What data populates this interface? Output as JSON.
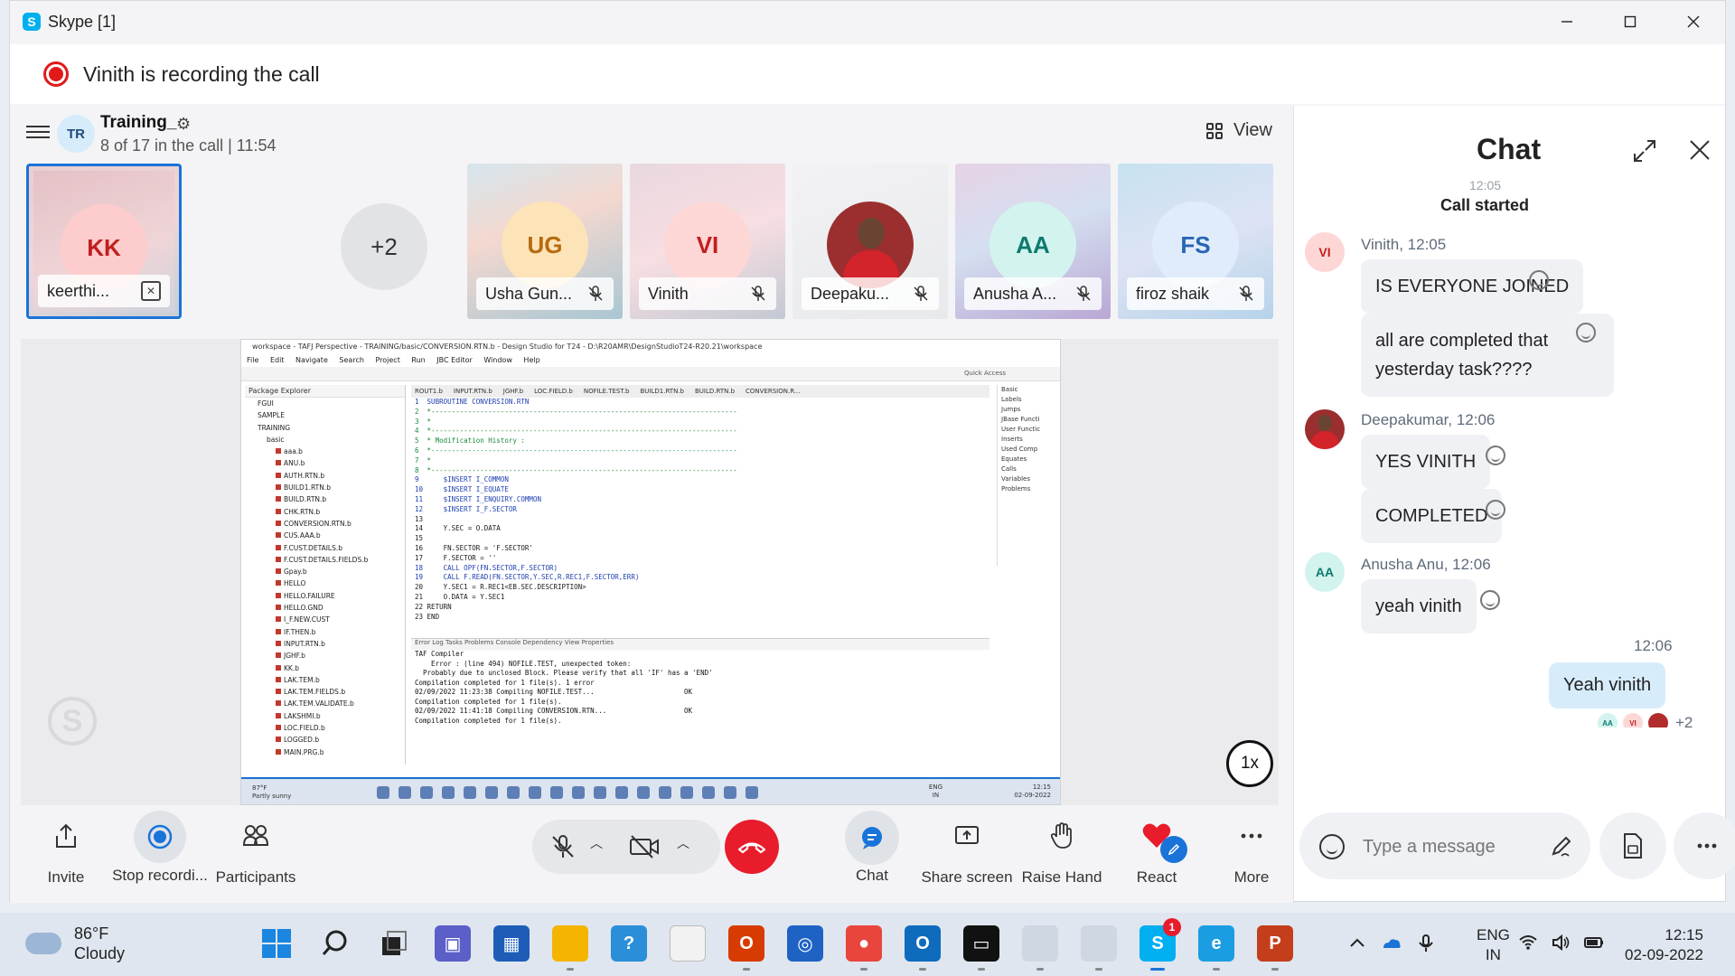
{
  "window": {
    "title": "Skype [1]"
  },
  "recording_banner": {
    "text": "Vinith is recording the call"
  },
  "call": {
    "group_initials": "TR",
    "group_name": "Training_",
    "status": "8 of 17 in the call | 11:54",
    "view_label": "View",
    "overflow_count": "+2"
  },
  "participants": [
    {
      "initials": "KK",
      "name": "keerthi..."
    },
    {
      "initials": "UG",
      "name": "Usha Gun..."
    },
    {
      "initials": "VI",
      "name": "Vinith"
    },
    {
      "initials": "",
      "name": "Deepaku..."
    },
    {
      "initials": "AA",
      "name": "Anusha A..."
    },
    {
      "initials": "FS",
      "name": "firoz shaik"
    }
  ],
  "shared_screen": {
    "speed": "1x",
    "window_title": "workspace - TAFJ Perspective - TRAINING/basic/CONVERSION.RTN.b - Design Studio for T24 - D:\\R20AMR\\DesignStudioT24-R20.21\\workspace",
    "menu": [
      "File",
      "Edit",
      "Navigate",
      "Search",
      "Project",
      "Run",
      "JBC Editor",
      "Window",
      "Help"
    ],
    "quick_access": "Quick Access",
    "package_explorer_title": "Package Explorer",
    "tree": [
      {
        "t": "FGUI",
        "l": 1
      },
      {
        "t": "SAMPLE",
        "l": 1
      },
      {
        "t": "TRAINING",
        "l": 1
      },
      {
        "t": "basic",
        "l": 2
      },
      {
        "t": "aaa.b",
        "l": 3
      },
      {
        "t": "ANU.b",
        "l": 3
      },
      {
        "t": "AUTH.RTN.b",
        "l": 3
      },
      {
        "t": "BUILD1.RTN.b",
        "l": 3
      },
      {
        "t": "BUILD.RTN.b",
        "l": 3
      },
      {
        "t": "CHK.RTN.b",
        "l": 3
      },
      {
        "t": "CONVERSION.RTN.b",
        "l": 3
      },
      {
        "t": "CUS.AAA.b",
        "l": 3
      },
      {
        "t": "F.CUST.DETAILS.b",
        "l": 3
      },
      {
        "t": "F.CUST.DETAILS.FIELDS.b",
        "l": 3
      },
      {
        "t": "Gpay.b",
        "l": 3
      },
      {
        "t": "HELLO",
        "l": 3
      },
      {
        "t": "HELLO.FAILURE",
        "l": 3
      },
      {
        "t": "HELLO.GND",
        "l": 3
      },
      {
        "t": "I_F.NEW.CUST",
        "l": 3
      },
      {
        "t": "IF.THEN.b",
        "l": 3
      },
      {
        "t": "INPUT.RTN.b",
        "l": 3
      },
      {
        "t": "JGHF.b",
        "l": 3
      },
      {
        "t": "KK.b",
        "l": 3
      },
      {
        "t": "LAK.TEM.b",
        "l": 3
      },
      {
        "t": "LAK.TEM.FIELDS.b",
        "l": 3
      },
      {
        "t": "LAK.TEM.VALIDATE.b",
        "l": 3
      },
      {
        "t": "LAKSHMI.b",
        "l": 3
      },
      {
        "t": "LOC.FIELD.b",
        "l": 3
      },
      {
        "t": "LOGGED.b",
        "l": 3
      },
      {
        "t": "MAIN.PRG.b",
        "l": 3
      }
    ],
    "editor_tabs": [
      "ROUT1.b",
      "INPUT.RTN.b",
      "JGHF.b",
      "LOC.FIELD.b",
      "NOFILE.TEST.b",
      "BUILD1.RTN.b",
      "BUILD.RTN.b",
      "CONVERSION.R..."
    ],
    "code_lines": [
      "1  SUBROUTINE CONVERSION.RTN",
      "2  *---------------------------------------------------------------------------",
      "3  *",
      "4  *---------------------------------------------------------------------------",
      "5  * Modification History :",
      "6  *---------------------------------------------------------------------------",
      "7  *",
      "8  *---------------------------------------------------------------------------",
      "9      $INSERT I_COMMON",
      "10     $INSERT I_EQUATE",
      "11     $INSERT I_ENQUIRY.COMMON",
      "12     $INSERT I_F.SECTOR",
      "13",
      "14     Y.SEC = O.DATA",
      "15",
      "16     FN.SECTOR = 'F.SECTOR'",
      "17     F.SECTOR = ''",
      "18     CALL OPF(FN.SECTOR,F.SECTOR)",
      "19     CALL F.READ(FN.SECTOR,Y.SEC,R.REC1,F.SECTOR,ERR)",
      "20     Y.SEC1 = R.REC1<EB.SEC.DESCRIPTION>",
      "21     O.DATA = Y.SEC1",
      "22 RETURN",
      "23 END"
    ],
    "outline": [
      "Basic",
      "Labels",
      "Jumps",
      "JBase Functi",
      "User Functic",
      "Inserts",
      "Used Comp",
      "Equates",
      "Calls",
      "Variables",
      "Problems"
    ],
    "console_tabs": "Error Log  Tasks  Problems  Console  Dependency View  Properties",
    "console_lines": [
      "TAF Compiler",
      "    Error : (line 494) NOFILE.TEST, unexpected token:",
      "  Probably due to unclosed Block. Please verify that all 'IF' has a 'END'",
      "Compilation completed for 1 file(s). 1 error",
      "02/09/2022 11:23:38 Compiling NOFILE.TEST...                      OK",
      "Compilation completed for 1 file(s).",
      "02/09/2022 11:41:18 Compiling CONVERSION.RTN...                   OK",
      "Compilation completed for 1 file(s)."
    ],
    "taskbar": {
      "temp": "87°F",
      "condition": "Partly sunny",
      "lang1": "ENG",
      "lang2": "IN",
      "time": "12:15",
      "date": "02-09-2022"
    }
  },
  "controls": {
    "invite": "Invite",
    "stop_recording": "Stop recordi...",
    "participants": "Participants",
    "chat": "Chat",
    "share_screen": "Share screen",
    "raise_hand": "Raise Hand",
    "react": "React",
    "more": "More"
  },
  "chat": {
    "title": "Chat",
    "cut_time": "12:05",
    "call_started": "Call started",
    "messages": [
      {
        "initials": "VI",
        "meta": "Vinith, 12:05",
        "texts": [
          "IS EVERYONE JOINED",
          "all are completed that yesterday task????"
        ]
      },
      {
        "initials": "",
        "meta": "Deepakumar, 12:06",
        "texts": [
          "YES VINITH",
          "COMPLETED"
        ]
      },
      {
        "initials": "AA",
        "meta": "Anusha Anu, 12:06",
        "texts": [
          "yeah vinith"
        ]
      }
    ],
    "own_time": "12:06",
    "own_message": "Yeah vinith",
    "read_receipts": [
      "AA",
      "VI"
    ],
    "read_more": "+2",
    "input_placeholder": "Type a message"
  },
  "taskbar": {
    "temp": "86°F",
    "condition": "Cloudy",
    "lang1": "ENG",
    "lang2": "IN",
    "time": "12:15",
    "date": "02-09-2022",
    "skype_badge": "1"
  },
  "colors": {
    "accent": "#1a73d9",
    "record_red": "#e01919",
    "end_call": "#e81c2b",
    "own_bubble": "#d7ecfb"
  }
}
